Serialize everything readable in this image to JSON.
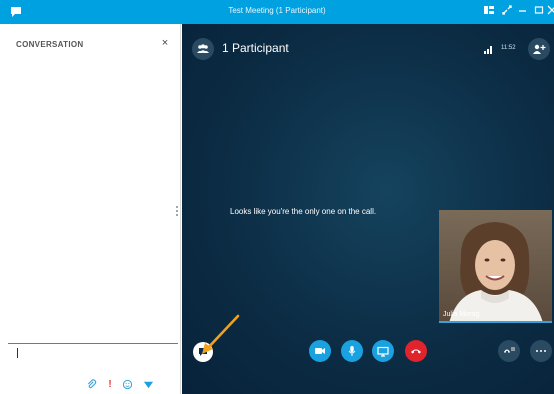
{
  "window": {
    "title": "Test Meeting (1 Participant)"
  },
  "conversation": {
    "header": "CONVERSATION",
    "close_glyph": "×"
  },
  "meeting": {
    "participants_label": "1 Participant",
    "time": "11:52",
    "empty_message": "Looks like you're the only one on the call.",
    "video_name": "Julia Morog"
  },
  "icons": {
    "app": "chat-bubble-icon",
    "window_controls": [
      "layout-icon",
      "fullscreen-icon",
      "minimize-icon",
      "maximize-icon",
      "close-icon"
    ],
    "convo_tools": [
      "attachment-icon",
      "importance-icon",
      "emoji-icon",
      "send-icon"
    ],
    "meeting_top": [
      "participants-icon",
      "signal-icon",
      "add-person-icon"
    ],
    "meeting_bottom": [
      "chat-icon",
      "video-icon",
      "microphone-icon",
      "share-screen-icon",
      "hang-up-icon",
      "dialpad-icon",
      "more-icon"
    ]
  },
  "colors": {
    "titlebar": "#00a1e0",
    "stage": "#0c2d45",
    "accent": "#1aa1e0",
    "hangup": "#e0242c",
    "annotation": "#f4a11a"
  }
}
